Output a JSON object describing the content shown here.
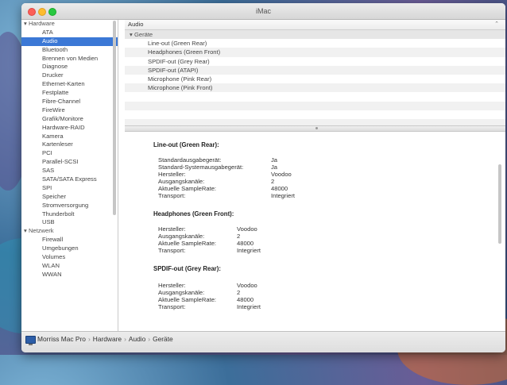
{
  "window": {
    "title": "iMac"
  },
  "sidebar": {
    "groups": [
      {
        "label": "Hardware",
        "items": [
          "ATA",
          "Audio",
          "Bluetooth",
          "Brennen von Medien",
          "Diagnose",
          "Drucker",
          "Ethernet-Karten",
          "Festplatte",
          "Fibre-Channel",
          "FireWire",
          "Grafik/Monitore",
          "Hardware-RAID",
          "Kamera",
          "Kartenleser",
          "PCI",
          "Parallel-SCSI",
          "SAS",
          "SATA/SATA Express",
          "SPI",
          "Speicher",
          "Stromversorgung",
          "Thunderbolt",
          "USB"
        ]
      },
      {
        "label": "Netzwerk",
        "items": [
          "Firewall",
          "Umgebungen",
          "Volumes",
          "WLAN",
          "WWAN"
        ]
      }
    ],
    "selected": "Audio"
  },
  "main": {
    "header": "Audio",
    "tree": {
      "group_label": "Geräte",
      "devices": [
        "Line-out (Green Rear)",
        "Headphones (Green Front)",
        "SPDIF-out (Grey Rear)",
        "SPDIF-out (ATAPI)",
        "Microphone (Pink Rear)",
        "Microphone (Pink Front)"
      ]
    },
    "details": {
      "line_out": {
        "title": "Line-out (Green Rear):",
        "rows": [
          {
            "k": "Standardausgabegerät:",
            "v": "Ja"
          },
          {
            "k": "Standard-Systemausgabegerät:",
            "v": "Ja"
          },
          {
            "k": "Hersteller:",
            "v": "Voodoo"
          },
          {
            "k": "Ausgangskanäle:",
            "v": "2"
          },
          {
            "k": "Aktuelle SampleRate:",
            "v": "48000"
          },
          {
            "k": "Transport:",
            "v": "Integriert"
          }
        ]
      },
      "headphones": {
        "title": "Headphones (Green Front):",
        "rows": [
          {
            "k": "Hersteller:",
            "v": "Voodoo"
          },
          {
            "k": "Ausgangskanäle:",
            "v": "2"
          },
          {
            "k": "Aktuelle SampleRate:",
            "v": "48000"
          },
          {
            "k": "Transport:",
            "v": "Integriert"
          }
        ]
      },
      "spdif": {
        "title": "SPDIF-out (Grey Rear):",
        "rows": [
          {
            "k": "Hersteller:",
            "v": "Voodoo"
          },
          {
            "k": "Ausgangskanäle:",
            "v": "2"
          },
          {
            "k": "Aktuelle SampleRate:",
            "v": "48000"
          },
          {
            "k": "Transport:",
            "v": "Integriert"
          }
        ]
      }
    }
  },
  "pathbar": {
    "crumbs": [
      "Morriss Mac Pro",
      "Hardware",
      "Audio",
      "Geräte"
    ],
    "separator": "›"
  }
}
